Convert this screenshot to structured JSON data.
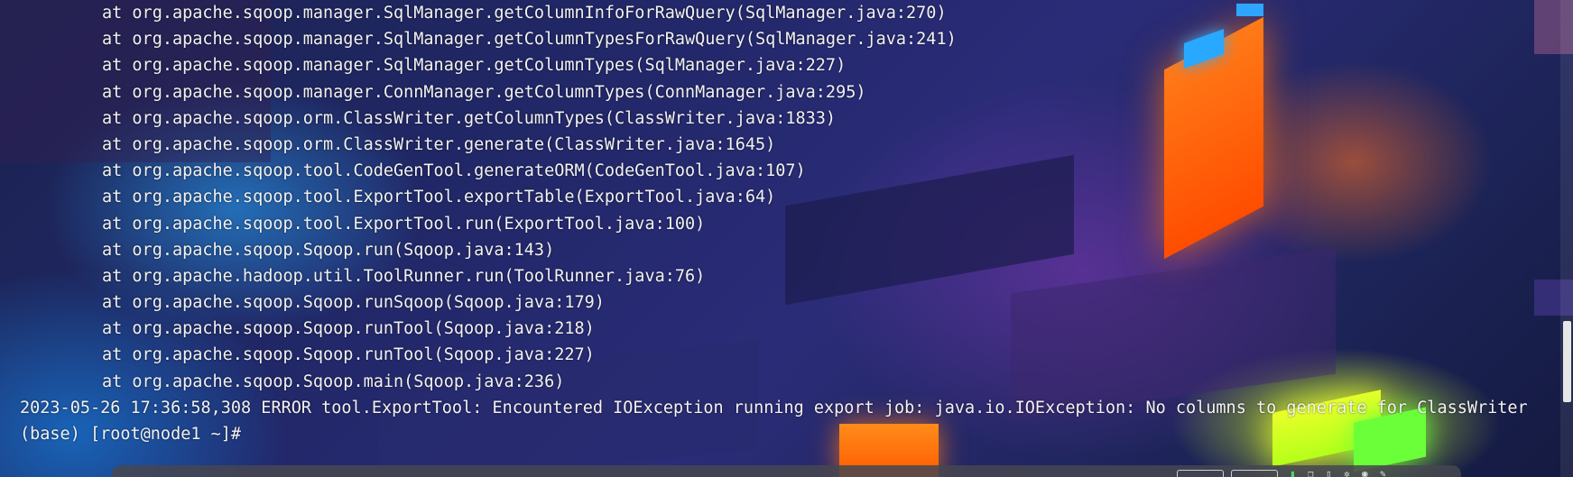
{
  "terminal": {
    "lines": [
      {
        "kind": "trace",
        "text": "at org.apache.sqoop.manager.SqlManager.getColumnInfoForRawQuery(SqlManager.java:270)"
      },
      {
        "kind": "trace",
        "text": "at org.apache.sqoop.manager.SqlManager.getColumnTypesForRawQuery(SqlManager.java:241)"
      },
      {
        "kind": "trace",
        "text": "at org.apache.sqoop.manager.SqlManager.getColumnTypes(SqlManager.java:227)"
      },
      {
        "kind": "trace",
        "text": "at org.apache.sqoop.manager.ConnManager.getColumnTypes(ConnManager.java:295)"
      },
      {
        "kind": "trace",
        "text": "at org.apache.sqoop.orm.ClassWriter.getColumnTypes(ClassWriter.java:1833)"
      },
      {
        "kind": "trace",
        "text": "at org.apache.sqoop.orm.ClassWriter.generate(ClassWriter.java:1645)"
      },
      {
        "kind": "trace",
        "text": "at org.apache.sqoop.tool.CodeGenTool.generateORM(CodeGenTool.java:107)"
      },
      {
        "kind": "trace",
        "text": "at org.apache.sqoop.tool.ExportTool.exportTable(ExportTool.java:64)"
      },
      {
        "kind": "trace",
        "text": "at org.apache.sqoop.tool.ExportTool.run(ExportTool.java:100)"
      },
      {
        "kind": "trace",
        "text": "at org.apache.sqoop.Sqoop.run(Sqoop.java:143)"
      },
      {
        "kind": "trace",
        "text": "at org.apache.hadoop.util.ToolRunner.run(ToolRunner.java:76)"
      },
      {
        "kind": "trace",
        "text": "at org.apache.sqoop.Sqoop.runSqoop(Sqoop.java:179)"
      },
      {
        "kind": "trace",
        "text": "at org.apache.sqoop.Sqoop.runTool(Sqoop.java:218)"
      },
      {
        "kind": "trace",
        "text": "at org.apache.sqoop.Sqoop.runTool(Sqoop.java:227)"
      },
      {
        "kind": "trace",
        "text": "at org.apache.sqoop.Sqoop.main(Sqoop.java:236)"
      },
      {
        "kind": "error",
        "text": "2023-05-26 17:36:58,308 ERROR tool.ExportTool: Encountered IOException running export job: java.io.IOException: No columns to generate for ClassWriter"
      },
      {
        "kind": "prompt",
        "text": "(base) [root@node1 ~]#"
      }
    ]
  },
  "colors": {
    "text": "#f2f2f2",
    "accent_orange": "#ff7a18",
    "accent_blue": "#29a8ff",
    "accent_lime": "#e9ff2a"
  }
}
